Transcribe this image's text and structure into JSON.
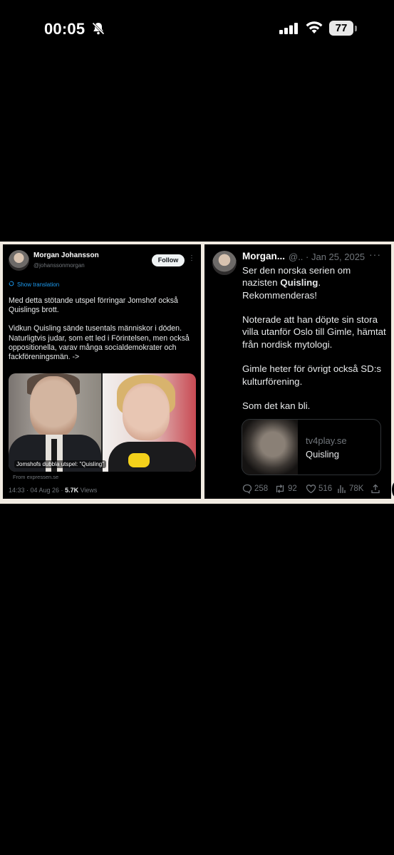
{
  "status_bar": {
    "time": "00:05",
    "battery": "77",
    "icons": [
      "bell-slash-icon",
      "cellular-signal-icon",
      "wifi-icon",
      "battery-icon"
    ]
  },
  "left_tweet": {
    "author_name": "Morgan Johansson",
    "handle": "@johanssonmorgan",
    "follow_label": "Follow",
    "more": "⋮",
    "translate_label": "Show translation",
    "paragraph_1": "Med detta stötande utspel förringar Jomshof också Quislings brott.",
    "paragraph_2": "Vidkun Quisling sände tusentals människor i döden. Naturligtvis judar, som ett led i Förintelsen, men också oppositionella, varav många socialdemokrater och fackföreningsmän. ->",
    "media_caption": "Jomshofs dubbla utspel: \"Quisling\"",
    "source": "From expressen.se",
    "timestamp": "14:33 · 04 Aug 26 · ",
    "views_count": "5.7K",
    "views_label": " Views"
  },
  "right_tweet": {
    "author_name": "Morgan...",
    "handle_date": "@.. · Jan 25, 2025",
    "more": "···",
    "line_1_pre": "Ser den norska serien om nazisten ",
    "line_1_bold": "Quisling",
    "line_1_post": ".",
    "line_2": "Rekommenderas!",
    "paragraph_2": "Noterade att han döpte sin stora villa utanför Oslo till Gimle, hämtat från nordisk mytologi.",
    "paragraph_3": "Gimle heter för övrigt också SD:s kulturförening.",
    "paragraph_4": "Som det kan bli.",
    "card_domain": "tv4play.se",
    "card_title": "Quisling",
    "replies": "258",
    "reposts": "92",
    "likes": "516",
    "views": "78K"
  },
  "colors": {
    "background": "#000000",
    "strip": "#f1ebe1",
    "link_blue": "#1d9bf0",
    "muted": "#71767b"
  }
}
